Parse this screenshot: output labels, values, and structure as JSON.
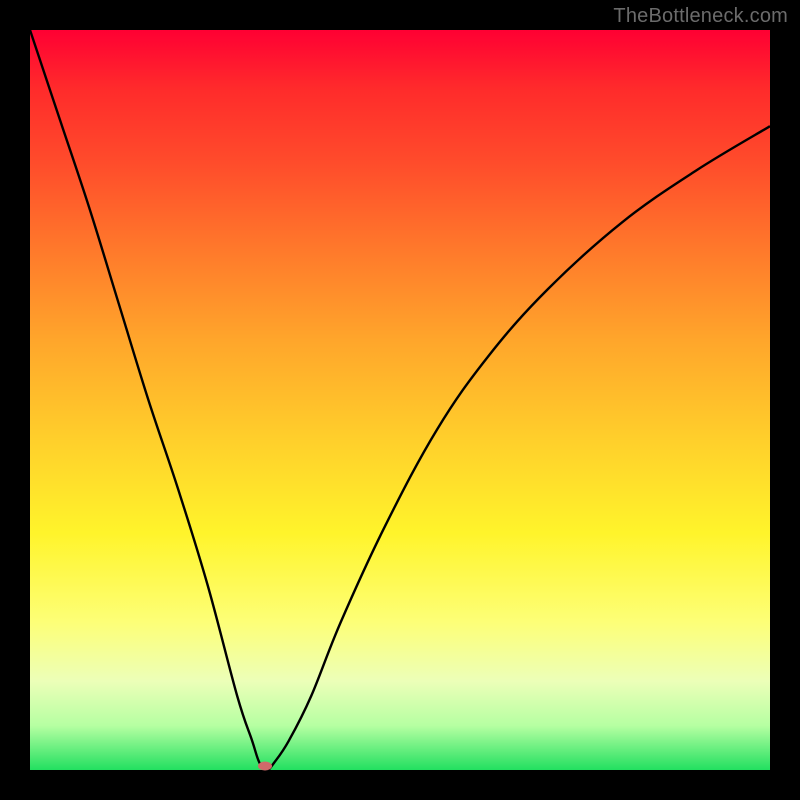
{
  "source_label": "TheBottleneck.com",
  "chart_data": {
    "type": "line",
    "title": "",
    "xlabel": "",
    "ylabel": "",
    "xlim": [
      0,
      100
    ],
    "ylim": [
      0,
      100
    ],
    "grid": false,
    "legend": false,
    "notes": "Background gradient runs from red (top, high bottleneck) through orange/yellow to green (bottom, optimal). A single black curve descends steeply from top-left into a narrow valley near x≈32%, touching y≈0, then rises on a slower convex path toward the upper-right. A small pink marker sits at the valley minimum.",
    "series": [
      {
        "name": "bottleneck-curve",
        "color": "#000000",
        "x": [
          0,
          4,
          8,
          12,
          16,
          20,
          24,
          28,
          30,
          31,
          32,
          33,
          35,
          38,
          42,
          48,
          55,
          62,
          70,
          80,
          90,
          100
        ],
        "y": [
          100,
          88,
          76,
          63,
          50,
          38,
          25,
          10,
          4,
          1,
          0,
          1,
          4,
          10,
          20,
          33,
          46,
          56,
          65,
          74,
          81,
          87
        ]
      }
    ],
    "marker": {
      "x": 31.7,
      "y": 0.5,
      "color": "#d16a6a"
    },
    "gradient_stops": [
      {
        "pct": 0,
        "color": "#ff0033"
      },
      {
        "pct": 50,
        "color": "#ffce2b"
      },
      {
        "pct": 100,
        "color": "#22e060"
      }
    ]
  }
}
